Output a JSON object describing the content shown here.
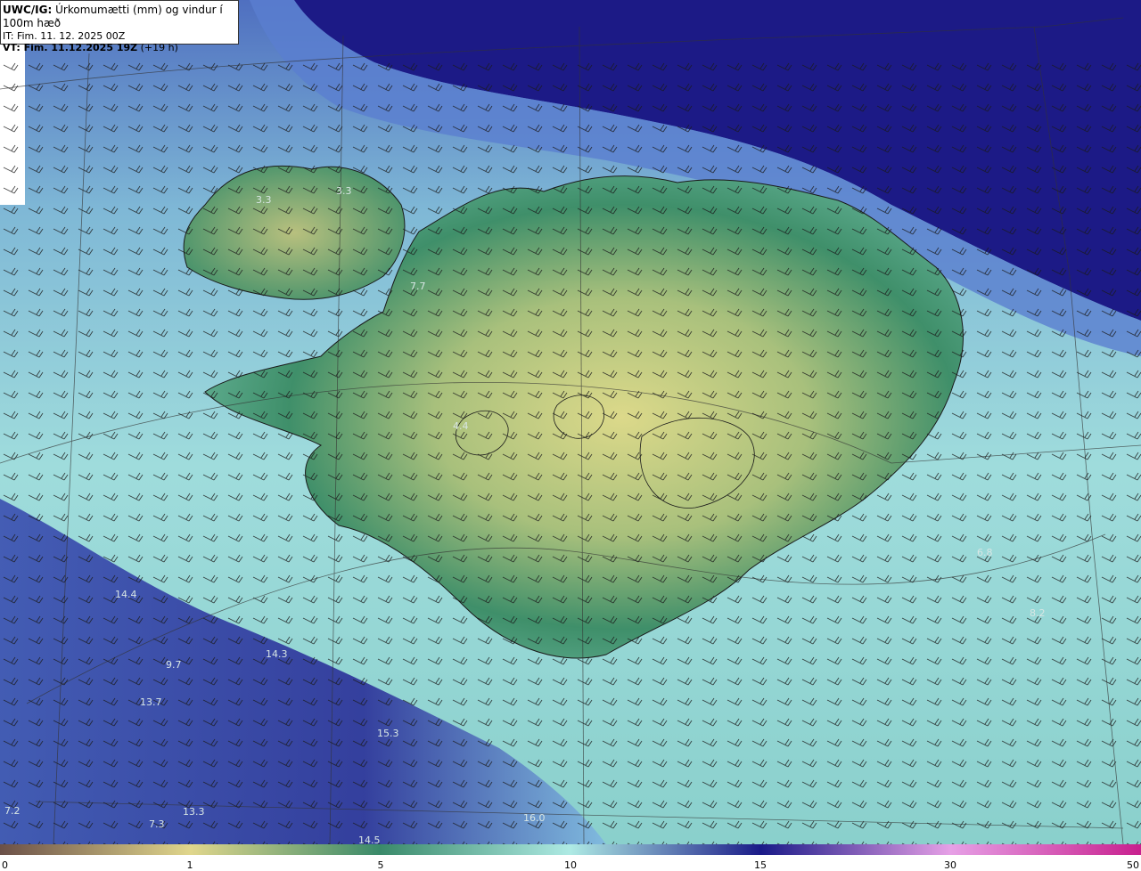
{
  "header": {
    "product": "UWC/IG:",
    "title": "Úrkomumætti (mm) og vindur í 100m hæð",
    "issue_time": "IT: Fim. 11. 12. 2025 00Z",
    "valid_label": "VT: Fim. 11.12.2025 19Z",
    "valid_offset": "(+19 h)"
  },
  "colorbar": {
    "ticks": [
      {
        "label": "0",
        "value": 0
      },
      {
        "label": "1",
        "value": 1
      },
      {
        "label": "5",
        "value": 5
      },
      {
        "label": "10",
        "value": 10
      },
      {
        "label": "15",
        "value": 15
      },
      {
        "label": "30",
        "value": 30
      },
      {
        "label": "50",
        "value": 50
      }
    ],
    "colors": [
      "#6b5048",
      "#e0d68c",
      "#3a8a6a",
      "#aeeae4",
      "#1a1a88",
      "#e6a0e6",
      "#c8208e"
    ]
  },
  "field_labels": [
    "3.3",
    "3.3",
    "7.7",
    "4.4",
    "6.8",
    "8.2",
    "14.4",
    "14.3",
    "9.7",
    "13.7",
    "15.3",
    "16.0",
    "13.3",
    "7.2",
    "7.3",
    "14.5"
  ],
  "colors": {
    "ocean_deep": "#1c1a86",
    "ocean_mid": "#4a62b8",
    "ocean_light": "#a6e2e2",
    "land_low": "#3f8f6a",
    "land_high": "#dbd98a"
  }
}
